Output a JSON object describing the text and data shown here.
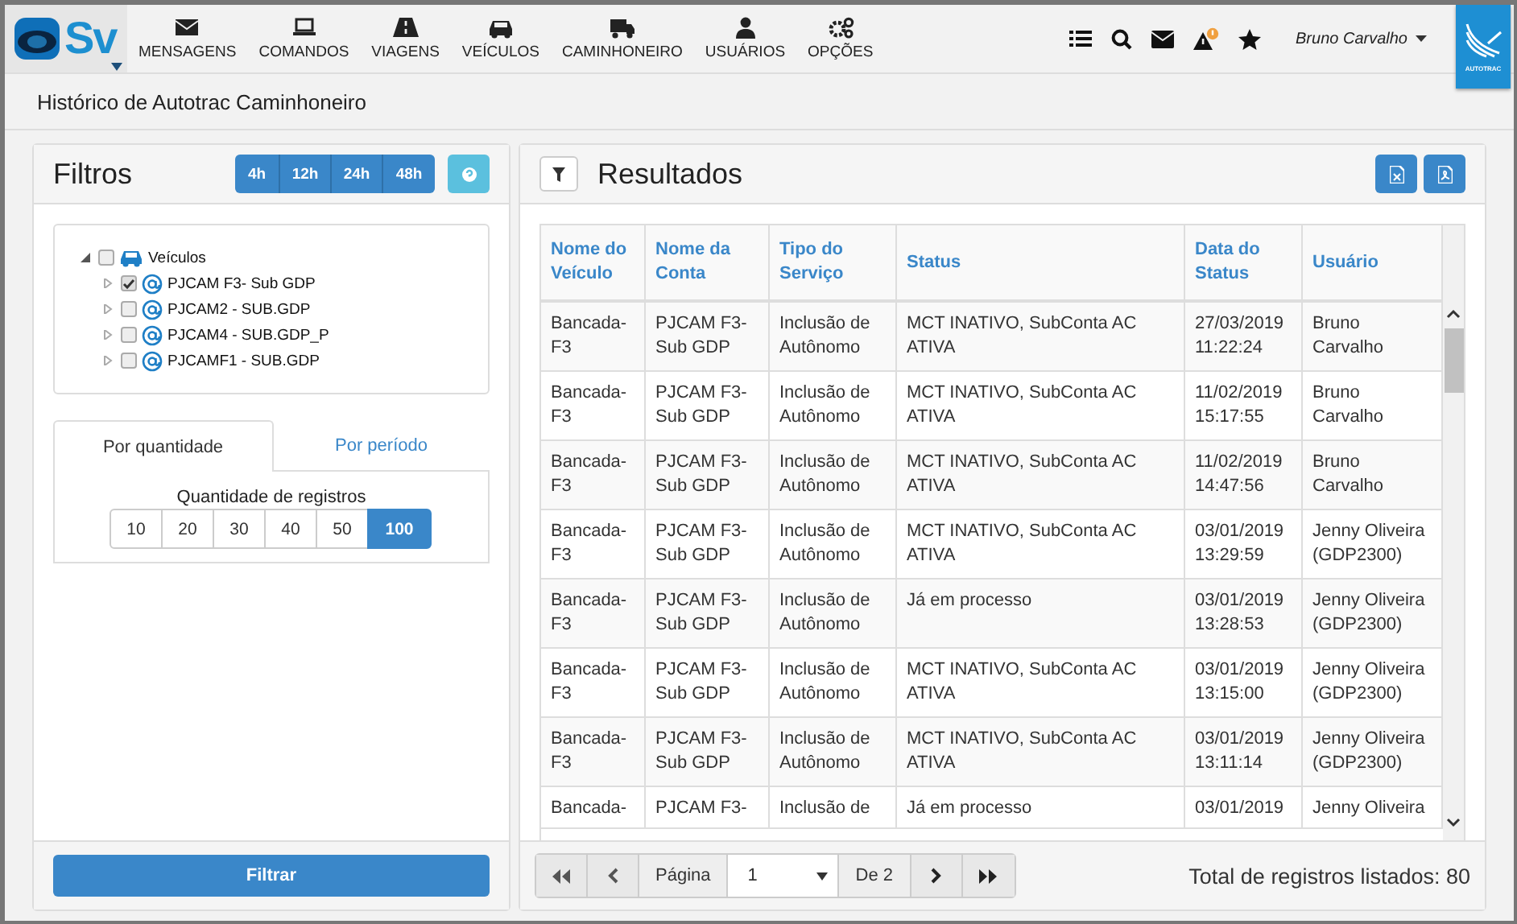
{
  "app_logo": {
    "text": "Sv"
  },
  "nav": [
    {
      "label": "MENSAGENS",
      "kind": "envelope"
    },
    {
      "label": "COMANDOS",
      "kind": "laptop"
    },
    {
      "label": "VIAGENS",
      "kind": "road"
    },
    {
      "label": "VEÍCULOS",
      "kind": "car"
    },
    {
      "label": "CAMINHONEIRO",
      "kind": "truck"
    },
    {
      "label": "USUÁRIOS",
      "kind": "user"
    },
    {
      "label": "OPÇÕES",
      "kind": "gears"
    }
  ],
  "user": {
    "name": "Bruno Carvalho"
  },
  "brand_logo": {
    "text": "AUTOTRAC"
  },
  "page_title": "Histórico de Autotrac Caminhoneiro",
  "filters": {
    "title": "Filtros",
    "time_buttons": [
      "4h",
      "12h",
      "24h",
      "48h"
    ],
    "tree": [
      {
        "label": "Veículos",
        "checked": false,
        "expanded": true,
        "children": [
          {
            "label": "PJCAM F3- Sub GDP",
            "checked": true,
            "expanded": false
          },
          {
            "label": "PJCAM2 - SUB.GDP",
            "checked": false,
            "expanded": false
          },
          {
            "label": "PJCAM4 - SUB.GDP_P",
            "checked": false,
            "expanded": false
          },
          {
            "label": "PJCAMF1 - SUB.GDP",
            "checked": false,
            "expanded": false
          }
        ]
      }
    ],
    "tabs": [
      {
        "label": "Por quantidade",
        "selected": true
      },
      {
        "label": "Por período",
        "selected": false
      }
    ],
    "quantity_label": "Quantidade de registros",
    "quantities": [
      {
        "label": "10",
        "selected": false
      },
      {
        "label": "20",
        "selected": false
      },
      {
        "label": "30",
        "selected": false
      },
      {
        "label": "40",
        "selected": false
      },
      {
        "label": "50",
        "selected": false
      },
      {
        "label": "100",
        "selected": true
      }
    ],
    "filter_button": "Filtrar"
  },
  "results": {
    "title": "Resultados",
    "table": {
      "columns": [
        "Nome do Veículo",
        "Nome da Conta",
        "Tipo do Serviço",
        "Status",
        "Data do Status",
        "Usuário"
      ],
      "rows": [
        [
          "Bancada-F3",
          "PJCAM F3-Sub GDP",
          "Inclusão de Autônomo",
          "MCT INATIVO, SubConta AC ATIVA",
          "27/03/2019 11:22:24",
          "Bruno Carvalho"
        ],
        [
          "Bancada-F3",
          "PJCAM F3-Sub GDP",
          "Inclusão de Autônomo",
          "MCT INATIVO, SubConta AC ATIVA",
          "11/02/2019 15:17:55",
          "Bruno Carvalho"
        ],
        [
          "Bancada-F3",
          "PJCAM F3-Sub GDP",
          "Inclusão de Autônomo",
          "MCT INATIVO, SubConta AC ATIVA",
          "11/02/2019 14:47:56",
          "Bruno Carvalho"
        ],
        [
          "Bancada-F3",
          "PJCAM F3-Sub GDP",
          "Inclusão de Autônomo",
          "MCT INATIVO, SubConta AC ATIVA",
          "03/01/2019 13:29:59",
          "Jenny Oliveira (GDP2300)"
        ],
        [
          "Bancada-F3",
          "PJCAM F3-Sub GDP",
          "Inclusão de Autônomo",
          "Já em processo",
          "03/01/2019 13:28:53",
          "Jenny Oliveira (GDP2300)"
        ],
        [
          "Bancada-F3",
          "PJCAM F3-Sub GDP",
          "Inclusão de Autônomo",
          "MCT INATIVO, SubConta AC ATIVA",
          "03/01/2019 13:15:00",
          "Jenny Oliveira (GDP2300)"
        ],
        [
          "Bancada-F3",
          "PJCAM F3-Sub GDP",
          "Inclusão de Autônomo",
          "MCT INATIVO, SubConta AC ATIVA",
          "03/01/2019 13:11:14",
          "Jenny Oliveira (GDP2300)"
        ],
        [
          "Bancada-",
          "PJCAM F3-",
          "Inclusão de",
          "Já em processo",
          "03/01/2019",
          "Jenny Oliveira"
        ]
      ]
    },
    "pagination": {
      "page_label": "Página",
      "page": "1",
      "of_label": "De 2"
    },
    "total": "Total de registros listados: 80"
  }
}
